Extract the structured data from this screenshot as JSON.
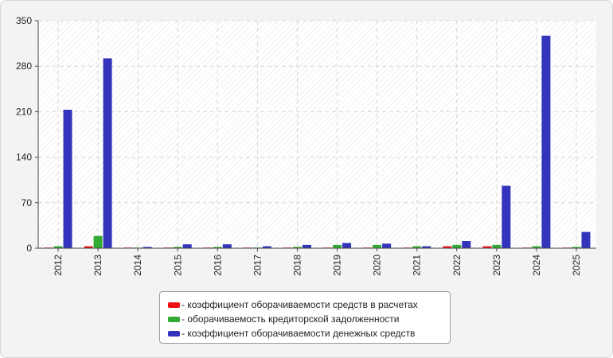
{
  "chart_data": {
    "type": "bar",
    "categories": [
      "2012",
      "2013",
      "2014",
      "2015",
      "2016",
      "2017",
      "2018",
      "2019",
      "2020",
      "2021",
      "2022",
      "2023",
      "2024",
      "2025"
    ],
    "ylim": [
      0,
      350
    ],
    "yticks": [
      0,
      70,
      140,
      210,
      280,
      350
    ],
    "grid": true,
    "legend_position": "bottom-center",
    "series": [
      {
        "name": "коэффициент оборачиваемости средств в расчетах",
        "color": "#ee1111",
        "values": [
          1,
          3,
          1,
          1,
          1,
          1,
          1,
          1,
          1,
          1,
          3,
          3,
          1,
          1
        ]
      },
      {
        "name": "оборачиваемость кредиторской задолженности",
        "color": "#33aa33",
        "values": [
          3,
          19,
          1,
          2,
          2,
          1,
          2,
          5,
          5,
          3,
          5,
          5,
          3,
          2
        ]
      },
      {
        "name": "коэффициент оборачиваемости денежных средств",
        "color": "#3333bb",
        "values": [
          213,
          292,
          2,
          6,
          6,
          3,
          5,
          8,
          7,
          3,
          11,
          96,
          327,
          25
        ]
      }
    ]
  },
  "legend": {
    "items": [
      {
        "label": "- коэффициент оборачиваемости средств в расчетах",
        "color": "#ee1111"
      },
      {
        "label": "- оборачиваемость кредиторской задолженности",
        "color": "#33aa33"
      },
      {
        "label": "- коэффициент оборачиваемости денежных средств",
        "color": "#3333bb"
      }
    ]
  }
}
